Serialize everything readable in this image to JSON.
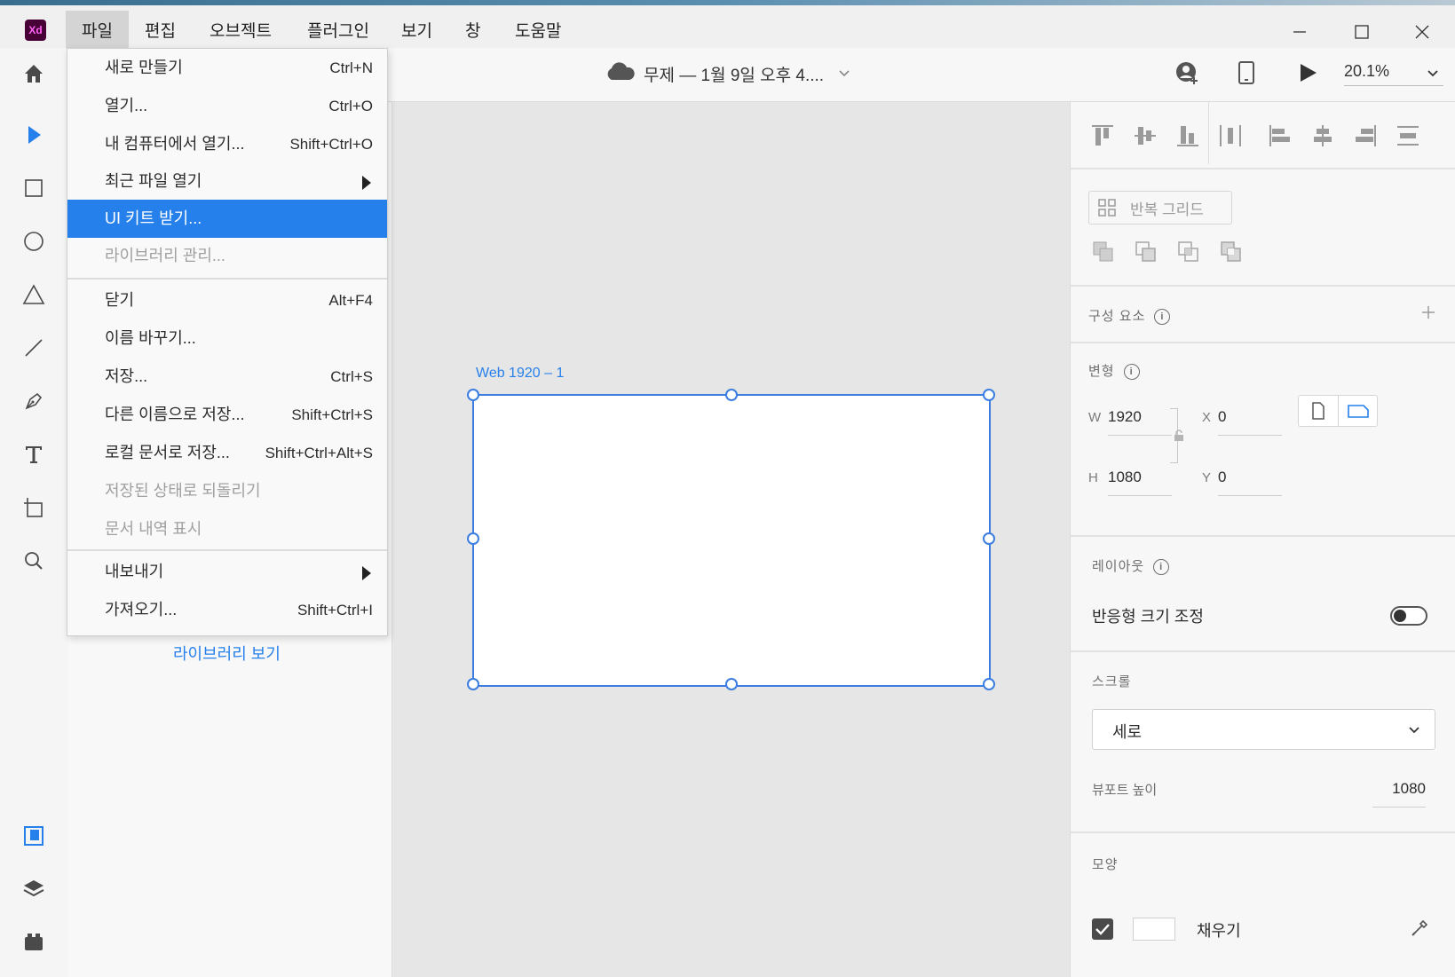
{
  "app": {
    "logo_text": "Xd"
  },
  "menubar": [
    {
      "label": "파일"
    },
    {
      "label": "편집"
    },
    {
      "label": "오브젝트"
    },
    {
      "label": "플러그인"
    },
    {
      "label": "보기"
    },
    {
      "label": "창"
    },
    {
      "label": "도움말"
    }
  ],
  "header": {
    "doc_title": "무제 — 1월 9일 오후 4....",
    "zoom": "20.1%"
  },
  "file_menu": {
    "items": [
      {
        "label": "새로 만들기",
        "shortcut": "Ctrl+N"
      },
      {
        "label": "열기...",
        "shortcut": "Ctrl+O"
      },
      {
        "label": "내 컴퓨터에서 열기...",
        "shortcut": "Shift+Ctrl+O"
      },
      {
        "label": "최근 파일 열기",
        "shortcut": ""
      },
      {
        "label": "UI 키트 받기...",
        "shortcut": ""
      },
      {
        "label": "라이브러리 관리...",
        "shortcut": ""
      },
      {
        "label": "닫기",
        "shortcut": "Alt+F4"
      },
      {
        "label": "이름 바꾸기...",
        "shortcut": ""
      },
      {
        "label": "저장...",
        "shortcut": "Ctrl+S"
      },
      {
        "label": "다른 이름으로 저장...",
        "shortcut": "Shift+Ctrl+S"
      },
      {
        "label": "로컬 문서로 저장...",
        "shortcut": "Shift+Ctrl+Alt+S"
      },
      {
        "label": "저장된 상태로 되돌리기",
        "shortcut": ""
      },
      {
        "label": "문서 내역 표시",
        "shortcut": ""
      },
      {
        "label": "내보내기",
        "shortcut": ""
      },
      {
        "label": "가져오기...",
        "shortcut": "Shift+Ctrl+I"
      }
    ]
  },
  "left_panel": {
    "library_link": "라이브러리 보기"
  },
  "canvas": {
    "artboard_label": "Web 1920 – 1"
  },
  "right_panel": {
    "repeat_grid": "반복 그리드",
    "components_title": "구성 요소",
    "transform_title": "변형",
    "w_label": "W",
    "w_value": "1920",
    "h_label": "H",
    "h_value": "1080",
    "x_label": "X",
    "x_value": "0",
    "y_label": "Y",
    "y_value": "0",
    "layout_title": "레이아웃",
    "responsive_resize": "반응형 크기 조정",
    "scroll_title": "스크롤",
    "scroll_value": "세로",
    "viewport_label": "뷰포트 높이",
    "viewport_value": "1080",
    "appearance_title": "모양",
    "fill_label": "채우기"
  },
  "colors": {
    "accent": "#2680eb",
    "artboard_border": "#3b7de0"
  }
}
